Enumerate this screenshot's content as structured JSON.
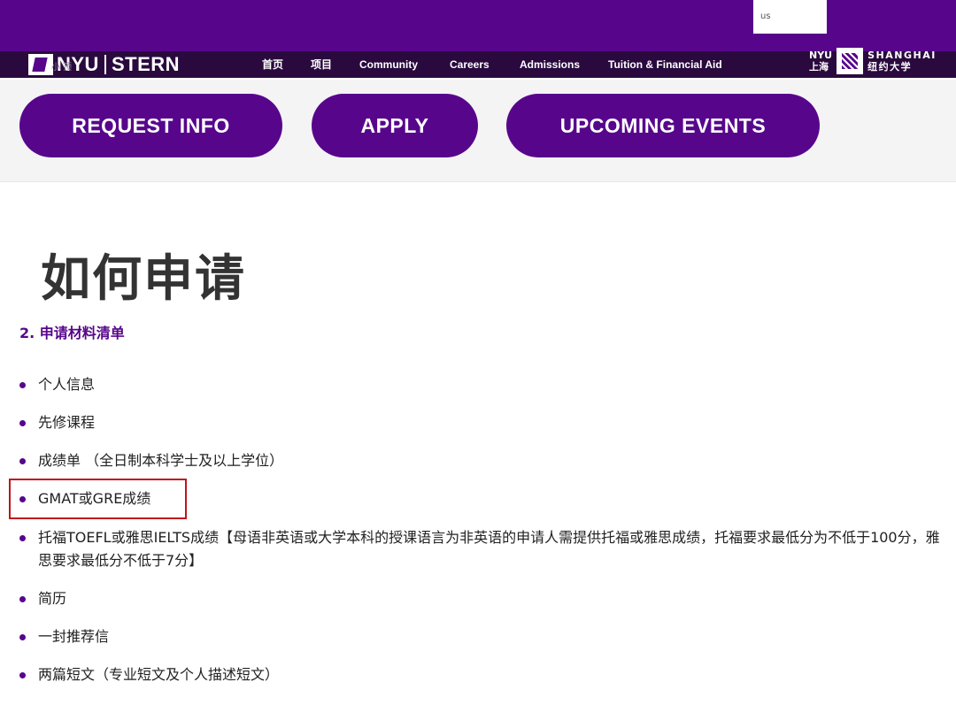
{
  "header": {
    "search_value": "us",
    "logo_nyu": "NYU",
    "logo_stern": "STERN",
    "logo_faint_text": "小 顶",
    "nav": [
      {
        "label": "首页"
      },
      {
        "label": "项目"
      },
      {
        "label": "Community"
      },
      {
        "label": "Careers"
      },
      {
        "label": "Admissions"
      },
      {
        "label": "Tuition & Financial Aid"
      }
    ],
    "shanghai_logo": {
      "nyu": "NYU",
      "shanghai_cn": "上海",
      "shanghai_en": "SHANGHAI",
      "niuyue_daxue": "纽约大学"
    }
  },
  "cta": {
    "request_info": "REQUEST INFO",
    "apply": "APPLY",
    "upcoming_events": "UPCOMING EVENTS"
  },
  "main": {
    "title": "如何申请",
    "section_heading": "2. 申请材料清单",
    "requirements": [
      "个人信息",
      "先修课程",
      "成绩单 （全日制本科学士及以上学位）",
      "GMAT或GRE成绩",
      "托福TOEFL或雅思IELTS成绩【母语非英语或大学本科的授课语言为非英语的申请人需提供托福或雅思成绩，托福要求最低分为不低于100分，雅思要求最低分不低于7分】",
      "简历",
      "一封推荐信",
      "两篇短文（专业短文及个人描述短文）"
    ]
  },
  "colors": {
    "brand_purple": "#57068c",
    "nav_dark": "#2a0a3e",
    "highlight_red": "#c0141e"
  }
}
